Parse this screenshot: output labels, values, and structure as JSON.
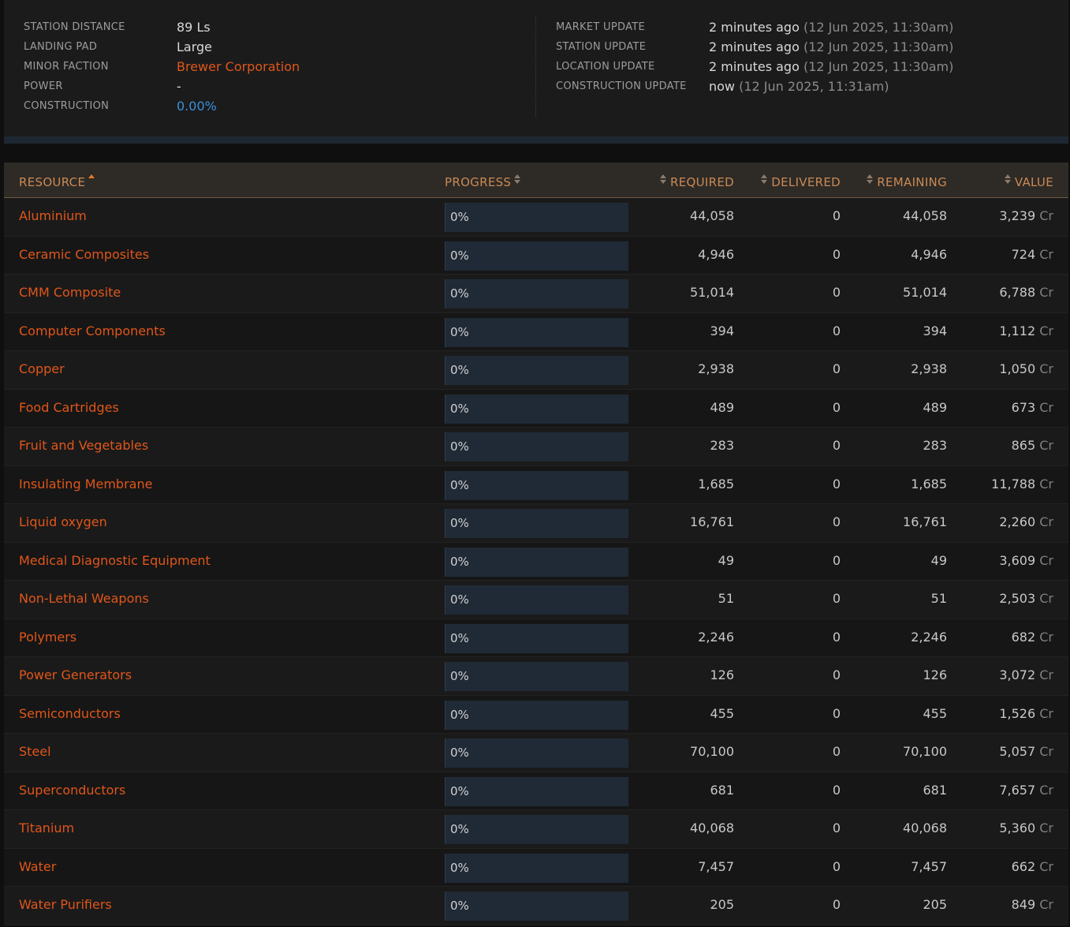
{
  "info": {
    "left": [
      {
        "label": "STATION DISTANCE",
        "value": "89 Ls",
        "style": "plain"
      },
      {
        "label": "LANDING PAD",
        "value": "Large",
        "style": "plain"
      },
      {
        "label": "MINOR FACTION",
        "value": "Brewer Corporation",
        "style": "link"
      },
      {
        "label": "POWER",
        "value": "-",
        "style": "plain"
      },
      {
        "label": "CONSTRUCTION",
        "value": "0.00%",
        "style": "blue"
      }
    ],
    "right": [
      {
        "label": "MARKET UPDATE",
        "value": "2 minutes ago",
        "detail": "(12 Jun 2025, 11:30am)"
      },
      {
        "label": "STATION UPDATE",
        "value": "2 minutes ago",
        "detail": "(12 Jun 2025, 11:30am)"
      },
      {
        "label": "LOCATION UPDATE",
        "value": "2 minutes ago",
        "detail": "(12 Jun 2025, 11:30am)"
      },
      {
        "label": "CONSTRUCTION UPDATE",
        "value": "now",
        "detail": "(12 Jun 2025, 11:31am)"
      }
    ]
  },
  "table": {
    "headers": {
      "resource": "RESOURCE",
      "progress": "PROGRESS",
      "required": "REQUIRED",
      "delivered": "DELIVERED",
      "remaining": "REMAINING",
      "value": "VALUE"
    },
    "sort_column": "resource",
    "sort_direction": "asc",
    "currency": "Cr",
    "rows": [
      {
        "resource": "Aluminium",
        "progress": "0%",
        "progress_fraction": 0,
        "required": "44,058",
        "delivered": "0",
        "remaining": "44,058",
        "value": "3,239"
      },
      {
        "resource": "Ceramic Composites",
        "progress": "0%",
        "progress_fraction": 0,
        "required": "4,946",
        "delivered": "0",
        "remaining": "4,946",
        "value": "724"
      },
      {
        "resource": "CMM Composite",
        "progress": "0%",
        "progress_fraction": 0,
        "required": "51,014",
        "delivered": "0",
        "remaining": "51,014",
        "value": "6,788"
      },
      {
        "resource": "Computer Components",
        "progress": "0%",
        "progress_fraction": 0,
        "required": "394",
        "delivered": "0",
        "remaining": "394",
        "value": "1,112"
      },
      {
        "resource": "Copper",
        "progress": "0%",
        "progress_fraction": 0,
        "required": "2,938",
        "delivered": "0",
        "remaining": "2,938",
        "value": "1,050"
      },
      {
        "resource": "Food Cartridges",
        "progress": "0%",
        "progress_fraction": 0,
        "required": "489",
        "delivered": "0",
        "remaining": "489",
        "value": "673"
      },
      {
        "resource": "Fruit and Vegetables",
        "progress": "0%",
        "progress_fraction": 0,
        "required": "283",
        "delivered": "0",
        "remaining": "283",
        "value": "865"
      },
      {
        "resource": "Insulating Membrane",
        "progress": "0%",
        "progress_fraction": 0,
        "required": "1,685",
        "delivered": "0",
        "remaining": "1,685",
        "value": "11,788"
      },
      {
        "resource": "Liquid oxygen",
        "progress": "0%",
        "progress_fraction": 0,
        "required": "16,761",
        "delivered": "0",
        "remaining": "16,761",
        "value": "2,260"
      },
      {
        "resource": "Medical Diagnostic Equipment",
        "progress": "0%",
        "progress_fraction": 0,
        "required": "49",
        "delivered": "0",
        "remaining": "49",
        "value": "3,609"
      },
      {
        "resource": "Non-Lethal Weapons",
        "progress": "0%",
        "progress_fraction": 0,
        "required": "51",
        "delivered": "0",
        "remaining": "51",
        "value": "2,503"
      },
      {
        "resource": "Polymers",
        "progress": "0%",
        "progress_fraction": 0,
        "required": "2,246",
        "delivered": "0",
        "remaining": "2,246",
        "value": "682"
      },
      {
        "resource": "Power Generators",
        "progress": "0%",
        "progress_fraction": 0,
        "required": "126",
        "delivered": "0",
        "remaining": "126",
        "value": "3,072"
      },
      {
        "resource": "Semiconductors",
        "progress": "0%",
        "progress_fraction": 0,
        "required": "455",
        "delivered": "0",
        "remaining": "455",
        "value": "1,526"
      },
      {
        "resource": "Steel",
        "progress": "0%",
        "progress_fraction": 0,
        "required": "70,100",
        "delivered": "0",
        "remaining": "70,100",
        "value": "5,057"
      },
      {
        "resource": "Superconductors",
        "progress": "0%",
        "progress_fraction": 0,
        "required": "681",
        "delivered": "0",
        "remaining": "681",
        "value": "7,657"
      },
      {
        "resource": "Titanium",
        "progress": "0%",
        "progress_fraction": 0,
        "required": "40,068",
        "delivered": "0",
        "remaining": "40,068",
        "value": "5,360"
      },
      {
        "resource": "Water",
        "progress": "0%",
        "progress_fraction": 0,
        "required": "7,457",
        "delivered": "0",
        "remaining": "7,457",
        "value": "662"
      },
      {
        "resource": "Water Purifiers",
        "progress": "0%",
        "progress_fraction": 0,
        "required": "205",
        "delivered": "0",
        "remaining": "205",
        "value": "849"
      }
    ]
  },
  "colors": {
    "accent": "#e0561a",
    "header_text": "#c98a55",
    "progress_fill": "#3a8fd8"
  }
}
